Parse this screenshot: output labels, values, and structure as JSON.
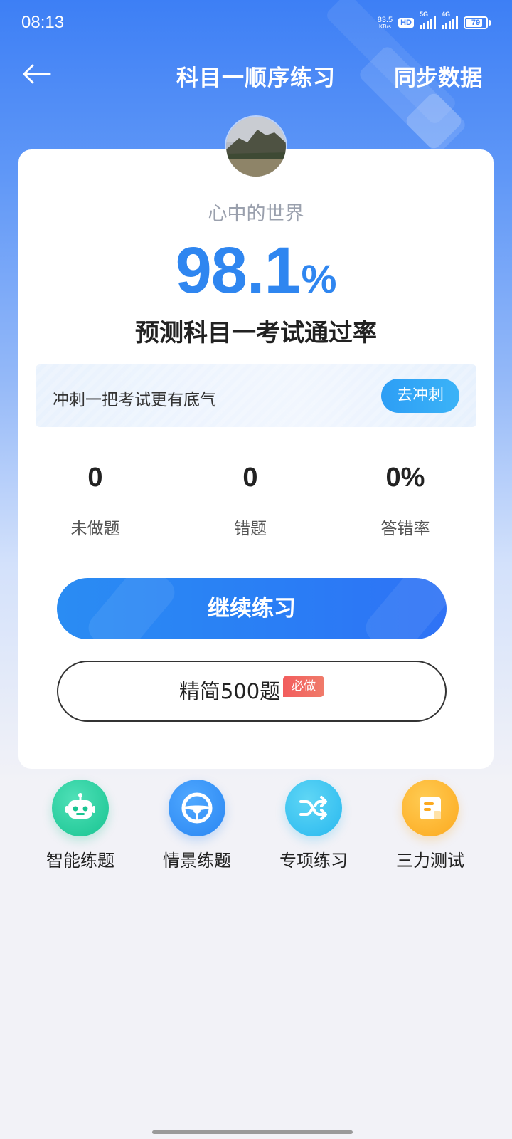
{
  "status_bar": {
    "time": "08:13",
    "net_speed_value": "83.5",
    "net_speed_unit": "KB/s",
    "hd_label": "HD",
    "signal1_label": "5G",
    "signal2_label": "4G",
    "battery": "79"
  },
  "nav": {
    "title": "科目一顺序练习",
    "sync_label": "同步数据",
    "back_icon": "arrow-left-icon"
  },
  "profile": {
    "username": "心中的世界"
  },
  "pass_rate": {
    "value": "98.1",
    "unit": "%",
    "label": "预测科目一考试通过率",
    "color": "#2f86f0"
  },
  "sprint": {
    "text": "冲刺一把考试更有底气",
    "button_label": "去冲刺"
  },
  "stats": [
    {
      "value": "0",
      "label": "未做题"
    },
    {
      "value": "0",
      "label": "错题"
    },
    {
      "value": "0%",
      "label": "答错率"
    }
  ],
  "actions": {
    "continue_label": "继续练习",
    "slim_label": "精简500题",
    "slim_badge": "必做"
  },
  "shortcuts": [
    {
      "label": "智能练题",
      "icon": "robot-icon",
      "color": "#18c491"
    },
    {
      "label": "情景练题",
      "icon": "steering-wheel-icon",
      "color": "#2a86f2"
    },
    {
      "label": "专项练习",
      "icon": "shuffle-icon",
      "color": "#28b8ef"
    },
    {
      "label": "三力测试",
      "icon": "document-icon",
      "color": "#fca91f"
    }
  ]
}
